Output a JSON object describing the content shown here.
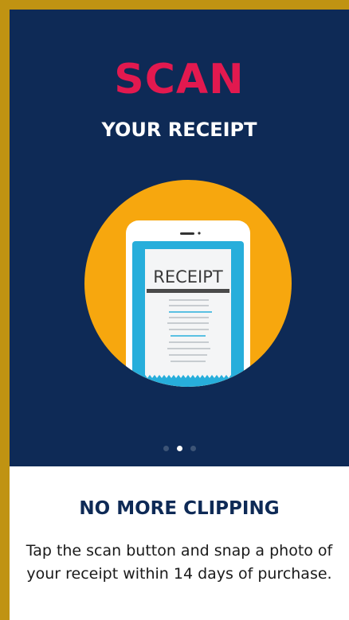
{
  "colors": {
    "frame_border": "#C09312",
    "hero_background": "#0E2A56",
    "headline_accent": "#E2194F",
    "illustration_circle": "#F7A70E",
    "phone_screen": "#27AEDB",
    "dot_active": "#FFFFFF",
    "dot_inactive": "#3D5476",
    "title_color": "#0E2A56"
  },
  "hero": {
    "headline": "SCAN",
    "subhead": "YOUR RECEIPT",
    "illustration": {
      "icon": "phone-receipt-icon",
      "receipt_label": "RECEIPT"
    }
  },
  "pagination": {
    "count": 3,
    "active_index": 1
  },
  "content": {
    "title": "NO MORE CLIPPING",
    "body": "Tap the scan button and snap a photo of your receipt within 14 days of purchase."
  }
}
